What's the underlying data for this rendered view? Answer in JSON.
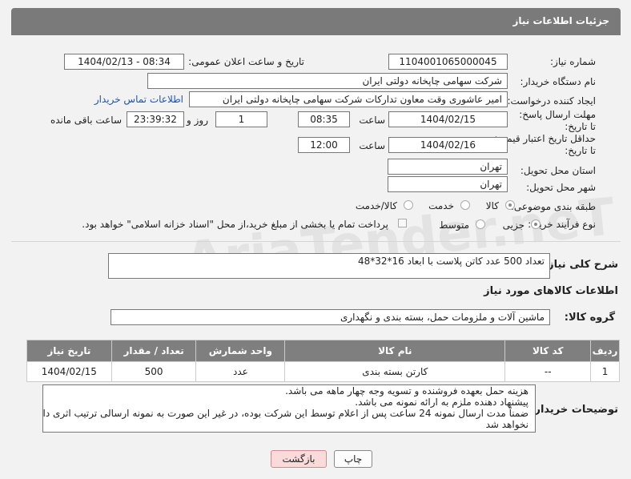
{
  "header": {
    "title": "جزئیات اطلاعات نیاز"
  },
  "fields": {
    "need_number_label": "شماره نیاز:",
    "need_number": "1104001065000045",
    "announce_label": "تاریخ و ساعت اعلان عمومی:",
    "announce_value": "1404/02/13 - 08:34",
    "buyer_org_label": "نام دستگاه خریدار:",
    "buyer_org": "شرکت سهامی چاپخانه دولتی ایران",
    "requester_label": "ایجاد کننده درخواست:",
    "requester": "امیر عاشوری وقت معاون تدارکات شرکت سهامی چاپخانه دولتی ایران",
    "contact_link": "اطلاعات تماس خریدار",
    "deadline_label": "مهلت ارسال پاسخ: تا تاریخ:",
    "deadline_date": "1404/02/15",
    "time_label": "ساعت",
    "deadline_time": "08:35",
    "days_value": "1",
    "days_label": "روز و",
    "remaining_value": "23:39:32",
    "remaining_label": "ساعت باقی مانده",
    "validity_label": "حداقل تاریخ اعتبار قیمت: تا تاریخ:",
    "validity_date": "1404/02/16",
    "validity_time": "12:00",
    "province_label": "استان محل تحویل:",
    "province": "تهران",
    "city_label": "شهر محل تحویل:",
    "city": "تهران",
    "category_label": "طبقه بندی موضوعی:",
    "cat_goods": "کالا",
    "cat_service": "خدمت",
    "cat_goods_service": "کالا/خدمت",
    "process_label": "نوع فرآیند خرید :",
    "proc_partial": "جزیی",
    "proc_medium": "متوسط",
    "payment_note": "پرداخت تمام یا بخشی از مبلغ خرید،از محل \"اسناد خزانه اسلامی\" خواهد بود."
  },
  "description": {
    "label": "شرح کلی نیاز:",
    "text": "تعداد 500 عدد کاتن پلاست با ابعاد 16*32*48"
  },
  "goods_section": {
    "title": "اطلاعات کالاهای مورد نیاز",
    "group_label": "گروه کالا:",
    "group_value": "ماشین آلات و ملزومات حمل، بسته بندی و نگهداری"
  },
  "table": {
    "headers": [
      "ردیف",
      "کد کالا",
      "نام کالا",
      "واحد شمارش",
      "تعداد / مقدار",
      "تاریخ نیاز"
    ],
    "rows": [
      [
        "1",
        "--",
        "کارتن بسته بندی",
        "عدد",
        "500",
        "1404/02/15"
      ]
    ]
  },
  "buyer_notes": {
    "label": "توضیحات خریدار:",
    "line1": "هزینه حمل بعهده فروشنده و تسویه وجه چهار ماهه می باشد.",
    "line2": "پیشنهاد دهنده ملزم به ارائه نمونه می باشد.",
    "line3": "ضمناً مدت ارسال نمونه 24 ساعت پس از اعلام توسط این شرکت بوده، در غیر این صورت به نمونه ارسالی ترتیب اثری داده",
    "line4": "نخواهد شد"
  },
  "buttons": {
    "print": "چاپ",
    "back": "بازگشت"
  },
  "watermark": "AriaTender.neT"
}
